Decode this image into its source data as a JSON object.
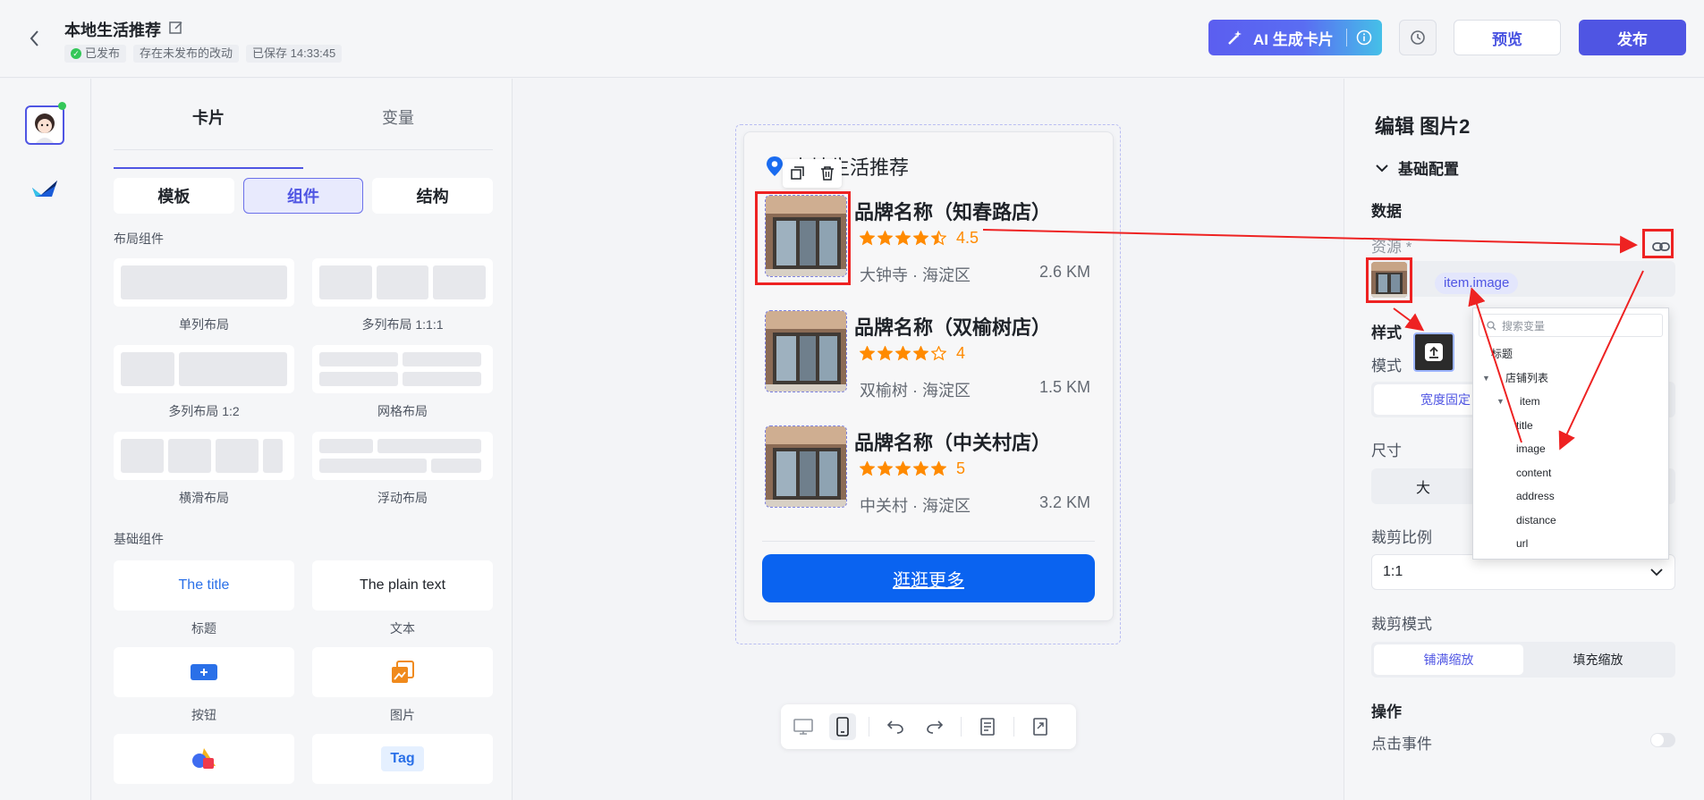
{
  "header": {
    "title": "本地生活推荐",
    "status_published": "已发布",
    "status_unpublished_changes": "存在未发布的改动",
    "saved_at": "已保存 14:33:45",
    "ai_button": "AI 生成卡片",
    "preview_button": "预览",
    "publish_button": "发布"
  },
  "left_panel": {
    "tabs": [
      "卡片",
      "变量"
    ],
    "segments": [
      "模板",
      "组件",
      "结构"
    ],
    "layout_group_label": "布局组件",
    "layout_items": [
      "单列布局",
      "多列布局 1:1:1",
      "多列布局 1:2",
      "网格布局",
      "横滑布局",
      "浮动布局"
    ],
    "base_group_label": "基础组件",
    "base_items": [
      {
        "preview": "The title",
        "label": "标题"
      },
      {
        "preview": "The plain text",
        "label": "文本"
      },
      {
        "preview": "",
        "label": "按钮"
      },
      {
        "preview": "",
        "label": "图片"
      },
      {
        "preview": "",
        "label": ""
      },
      {
        "preview": "Tag",
        "label": ""
      }
    ]
  },
  "card": {
    "title": "本地生活推荐",
    "shops": [
      {
        "name": "品牌名称（知春路店）",
        "stars": 4.5,
        "rating": "4.5",
        "address": "大钟寺 · 海淀区",
        "distance": "2.6 KM"
      },
      {
        "name": "品牌名称（双榆树店）",
        "stars": 4,
        "rating": "4",
        "address": "双榆树 · 海淀区",
        "distance": "1.5 KM"
      },
      {
        "name": "品牌名称（中关村店）",
        "stars": 5,
        "rating": "5",
        "address": "中关村 · 海淀区",
        "distance": "3.2 KM"
      }
    ],
    "more_button": "逛逛更多"
  },
  "right_panel": {
    "title": "编辑 图片2",
    "section": "基础配置",
    "data_label": "数据",
    "source_label": "资源 *",
    "variable_chip": "item.image",
    "style_label": "样式",
    "mode_label": "模式",
    "mode_value": "宽度固定",
    "size_label": "尺寸",
    "size_value": "大",
    "crop_ratio_label": "裁剪比例",
    "crop_ratio_value": "1:1",
    "crop_mode_label": "裁剪模式",
    "crop_modes": [
      "铺满缩放",
      "填充缩放"
    ],
    "action_label": "操作",
    "click_event_label": "点击事件"
  },
  "variable_dropdown": {
    "search_placeholder": "搜索变量",
    "items": [
      "标题",
      "店铺列表",
      "item",
      "title",
      "image",
      "content",
      "address",
      "distance",
      "url"
    ]
  },
  "colors": {
    "accent": "#4f55e3",
    "primary_button": "#0a63f0",
    "star": "#ff8a00",
    "annotation": "#ee2222"
  }
}
